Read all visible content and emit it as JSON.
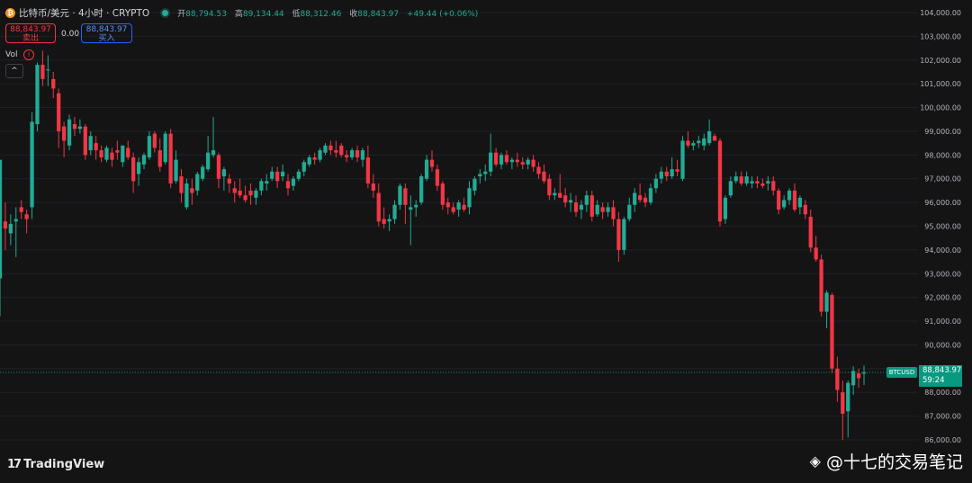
{
  "header": {
    "symbol_title": "比特币/美元 · 4小时 · CRYPTO",
    "open_label": "开",
    "open_value": "88,794.53",
    "high_label": "高",
    "high_value": "89,134.44",
    "low_label": "低",
    "low_value": "88,312.46",
    "close_label": "收",
    "close_value": "88,843.97",
    "change_value": "+49.44 (+0.06%)"
  },
  "trade": {
    "sell_price": "88,843.97",
    "sell_label": "卖出",
    "spread": "0.00",
    "buy_price": "88,843.97",
    "buy_label": "买入"
  },
  "volume": {
    "label": "Vol",
    "warn_icon": "!",
    "collapse_icon": "^"
  },
  "last_price": {
    "ticker": "BTCUSD",
    "price": "88,843.97",
    "countdown": "59:24"
  },
  "branding": {
    "logo_text": "TradingView",
    "watermark": "@十七的交易笔记"
  },
  "colors": {
    "up": "#22ab94",
    "down": "#f23645",
    "background": "#141414",
    "last_price": "#089981"
  },
  "chart_data": {
    "type": "candlestick",
    "title": "比特币/美元 · 4小时 · CRYPTO",
    "y_ticks": [
      86000,
      87000,
      88000,
      89000,
      90000,
      91000,
      92000,
      93000,
      94000,
      95000,
      96000,
      97000,
      98000,
      99000,
      100000,
      101000,
      102000,
      103000,
      104000
    ],
    "y_tick_labels": [
      "86,000.00",
      "87,000.00",
      "88,000.00",
      "89,000.00",
      "90,000.00",
      "91,000.00",
      "92,000.00",
      "93,000.00",
      "94,000.00",
      "95,000.00",
      "96,000.00",
      "97,000.00",
      "98,000.00",
      "99,000.00",
      "100,000.00",
      "101,000.00",
      "102,000.00",
      "103,000.00",
      "104,000.00"
    ],
    "ylim": [
      85500,
      104300
    ],
    "last_price": 88843.97,
    "grid": true,
    "candles": [
      [
        92800,
        97600,
        91200,
        97800
      ],
      [
        95200,
        96000,
        94000,
        94900
      ],
      [
        94700,
        95500,
        94200,
        95100
      ],
      [
        95200,
        95800,
        93700,
        95300
      ],
      [
        95800,
        96100,
        95300,
        95600
      ],
      [
        95500,
        95700,
        94700,
        95300
      ],
      [
        95800,
        99800,
        95300,
        99400
      ],
      [
        99300,
        101900,
        99000,
        101800
      ],
      [
        101800,
        102400,
        100900,
        101200
      ],
      [
        101600,
        102200,
        100900,
        101600
      ],
      [
        101200,
        101500,
        100400,
        100800
      ],
      [
        100600,
        100800,
        98300,
        99000
      ],
      [
        99200,
        99400,
        97900,
        98600
      ],
      [
        98400,
        99700,
        98200,
        99500
      ],
      [
        99300,
        99600,
        98800,
        99100
      ],
      [
        99100,
        99500,
        98900,
        99200
      ],
      [
        99200,
        99300,
        97800,
        98000
      ],
      [
        98200,
        99000,
        98000,
        98800
      ],
      [
        98500,
        98800,
        97800,
        98200
      ],
      [
        98200,
        98400,
        97700,
        97900
      ],
      [
        97800,
        98400,
        97700,
        98300
      ],
      [
        98100,
        98300,
        97500,
        97800
      ],
      [
        98200,
        98600,
        97800,
        98100
      ],
      [
        97700,
        98400,
        97500,
        98400
      ],
      [
        98300,
        98600,
        97800,
        97900
      ],
      [
        97900,
        98100,
        96400,
        96900
      ],
      [
        97200,
        97900,
        96700,
        97700
      ],
      [
        97600,
        98100,
        97400,
        98000
      ],
      [
        97900,
        99000,
        97800,
        98800
      ],
      [
        98900,
        99000,
        98100,
        98300
      ],
      [
        98200,
        98700,
        97300,
        97500
      ],
      [
        97700,
        99000,
        97600,
        98900
      ],
      [
        98900,
        99100,
        96600,
        96800
      ],
      [
        96900,
        98200,
        96800,
        97800
      ],
      [
        97100,
        97400,
        96000,
        96400
      ],
      [
        95800,
        97000,
        95700,
        96800
      ],
      [
        96600,
        97000,
        95900,
        96400
      ],
      [
        96500,
        97300,
        96300,
        97200
      ],
      [
        97000,
        97600,
        96900,
        97500
      ],
      [
        97400,
        98800,
        97300,
        98100
      ],
      [
        98000,
        99600,
        97900,
        98200
      ],
      [
        98000,
        98100,
        96600,
        97000
      ],
      [
        97100,
        97500,
        96500,
        97400
      ],
      [
        97000,
        97200,
        96400,
        96800
      ],
      [
        96600,
        96900,
        96000,
        96400
      ],
      [
        96500,
        97000,
        96200,
        96300
      ],
      [
        96300,
        96700,
        96000,
        96100
      ],
      [
        96500,
        96800,
        95900,
        96300
      ],
      [
        96200,
        96600,
        95900,
        96500
      ],
      [
        96500,
        97000,
        96300,
        96900
      ],
      [
        96800,
        97200,
        96500,
        96900
      ],
      [
        97000,
        97500,
        96900,
        97300
      ],
      [
        97300,
        97500,
        96600,
        96900
      ],
      [
        97100,
        97600,
        96900,
        97300
      ],
      [
        96900,
        97200,
        96300,
        96600
      ],
      [
        96700,
        97100,
        96500,
        97000
      ],
      [
        97000,
        97400,
        96900,
        97300
      ],
      [
        97300,
        97800,
        97100,
        97700
      ],
      [
        97600,
        98000,
        97500,
        97900
      ],
      [
        97900,
        98100,
        97600,
        97800
      ],
      [
        97800,
        98300,
        97700,
        98200
      ],
      [
        98100,
        98500,
        98000,
        98400
      ],
      [
        98400,
        98600,
        98000,
        98200
      ],
      [
        98200,
        98600,
        97900,
        98100
      ],
      [
        98400,
        98500,
        97900,
        98000
      ],
      [
        98000,
        98200,
        97700,
        97900
      ],
      [
        97900,
        98300,
        97800,
        98200
      ],
      [
        98200,
        98400,
        97700,
        97900
      ],
      [
        97800,
        98300,
        97500,
        98200
      ],
      [
        97900,
        98400,
        96600,
        96800
      ],
      [
        96800,
        97200,
        96200,
        96500
      ],
      [
        96400,
        96800,
        95000,
        95200
      ],
      [
        95300,
        95800,
        94900,
        95100
      ],
      [
        95200,
        95500,
        94800,
        95300
      ],
      [
        95300,
        96100,
        95100,
        95900
      ],
      [
        95900,
        96800,
        95700,
        96700
      ],
      [
        96600,
        96800,
        95100,
        95900
      ],
      [
        95700,
        96300,
        94200,
        95800
      ],
      [
        95800,
        96100,
        95400,
        95900
      ],
      [
        96000,
        97200,
        95900,
        97100
      ],
      [
        97000,
        98000,
        96900,
        97800
      ],
      [
        97800,
        98200,
        97300,
        97500
      ],
      [
        97400,
        97600,
        96500,
        96700
      ],
      [
        96800,
        96900,
        95700,
        95900
      ],
      [
        96000,
        96200,
        95500,
        95800
      ],
      [
        95800,
        96000,
        95500,
        95600
      ],
      [
        95700,
        96100,
        95400,
        96000
      ],
      [
        95900,
        96200,
        95600,
        95700
      ],
      [
        95800,
        96900,
        95500,
        96600
      ],
      [
        96500,
        97100,
        96300,
        97000
      ],
      [
        97100,
        97400,
        96800,
        97200
      ],
      [
        97200,
        97600,
        96900,
        97300
      ],
      [
        97300,
        98900,
        97100,
        98100
      ],
      [
        98100,
        98300,
        97500,
        97600
      ],
      [
        97600,
        98100,
        97400,
        98000
      ],
      [
        98000,
        98200,
        97600,
        97700
      ],
      [
        97700,
        97900,
        97400,
        97800
      ],
      [
        97800,
        98100,
        97500,
        97700
      ],
      [
        97700,
        97900,
        97400,
        97600
      ],
      [
        97600,
        97900,
        97400,
        97800
      ],
      [
        97800,
        98000,
        97300,
        97500
      ],
      [
        97500,
        97700,
        97000,
        97200
      ],
      [
        97300,
        97600,
        96800,
        96900
      ],
      [
        97000,
        97200,
        96100,
        96300
      ],
      [
        96300,
        96600,
        96100,
        96400
      ],
      [
        96400,
        97200,
        96200,
        96200
      ],
      [
        96300,
        96600,
        95800,
        96000
      ],
      [
        96000,
        96400,
        95600,
        96100
      ],
      [
        96000,
        96300,
        95400,
        95600
      ],
      [
        95700,
        96100,
        95300,
        95900
      ],
      [
        95900,
        96500,
        95600,
        96300
      ],
      [
        96300,
        96500,
        95200,
        95400
      ],
      [
        95500,
        96100,
        95400,
        95900
      ],
      [
        95800,
        96000,
        95300,
        95600
      ],
      [
        95600,
        96000,
        95400,
        95800
      ],
      [
        95800,
        96100,
        95000,
        95300
      ],
      [
        95300,
        95600,
        93500,
        94000
      ],
      [
        94000,
        95400,
        93800,
        95300
      ],
      [
        95300,
        96200,
        95200,
        95900
      ],
      [
        95900,
        96600,
        95600,
        96400
      ],
      [
        96300,
        96800,
        96000,
        96100
      ],
      [
        96200,
        96400,
        95800,
        96000
      ],
      [
        96000,
        96800,
        95900,
        96600
      ],
      [
        96600,
        97200,
        96400,
        97000
      ],
      [
        97000,
        97500,
        96800,
        97300
      ],
      [
        97300,
        97500,
        96900,
        97100
      ],
      [
        97100,
        97900,
        97000,
        97400
      ],
      [
        97400,
        97800,
        97100,
        97300
      ],
      [
        97000,
        98800,
        96900,
        98600
      ],
      [
        98600,
        99000,
        98300,
        98400
      ],
      [
        98400,
        98600,
        98200,
        98500
      ],
      [
        98500,
        98800,
        98300,
        98600
      ],
      [
        98400,
        98900,
        98200,
        98700
      ],
      [
        98500,
        99500,
        98400,
        99000
      ],
      [
        98800,
        98900,
        98600,
        98600
      ],
      [
        98600,
        98700,
        95000,
        95200
      ],
      [
        95300,
        96300,
        95100,
        96200
      ],
      [
        96300,
        97100,
        96200,
        96900
      ],
      [
        96900,
        97300,
        96800,
        97100
      ],
      [
        97100,
        97300,
        96700,
        96800
      ],
      [
        96800,
        97300,
        96700,
        97100
      ],
      [
        96800,
        97100,
        96600,
        96900
      ],
      [
        96900,
        97100,
        96600,
        96800
      ],
      [
        96800,
        97000,
        96600,
        96700
      ],
      [
        96800,
        97100,
        96500,
        96900
      ],
      [
        96900,
        97100,
        96300,
        96500
      ],
      [
        96500,
        96600,
        95500,
        95700
      ],
      [
        95800,
        96300,
        95700,
        96100
      ],
      [
        96100,
        96600,
        95900,
        96500
      ],
      [
        96500,
        96800,
        95600,
        95700
      ],
      [
        95800,
        96300,
        95500,
        96200
      ],
      [
        95900,
        96100,
        95300,
        95500
      ],
      [
        95400,
        95700,
        93900,
        94100
      ],
      [
        94100,
        94600,
        93500,
        93600
      ],
      [
        93600,
        93800,
        91200,
        91400
      ],
      [
        91400,
        92300,
        90700,
        92200
      ],
      [
        92100,
        92200,
        88800,
        89000
      ],
      [
        89000,
        89500,
        87600,
        88100
      ],
      [
        88000,
        88500,
        86000,
        87100
      ],
      [
        87200,
        88500,
        86100,
        88400
      ],
      [
        88300,
        89100,
        87900,
        88900
      ],
      [
        88800,
        89000,
        88200,
        88600
      ],
      [
        88790,
        89130,
        88310,
        88840
      ]
    ]
  }
}
